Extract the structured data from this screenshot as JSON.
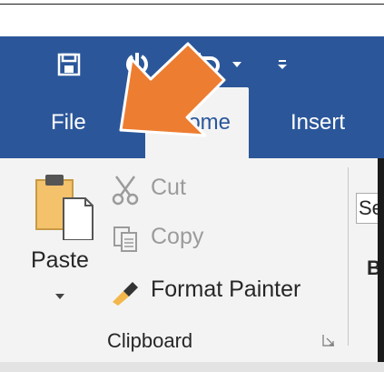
{
  "qat": {
    "save_icon": "save-icon",
    "autosave_icon": "autosave-refresh-icon",
    "undo_icon": "undo-icon",
    "undo_dropdown_icon": "chevron-down-icon",
    "customize_icon": "customize-qat-icon"
  },
  "tabs": [
    {
      "label": "File"
    },
    {
      "label": "Home"
    },
    {
      "label": "Insert"
    }
  ],
  "clipboard": {
    "paste_label": "Paste",
    "cut_label": "Cut",
    "copy_label": "Copy",
    "format_painter_label": "Format Painter",
    "group_label": "Clipboard"
  },
  "font_group": {
    "font_name_partial": "Se",
    "bold_label": "B"
  },
  "colors": {
    "ribbon_blue": "#2b579a",
    "ribbon_bg": "#f3f3f3",
    "annotation_arrow": "#ed7d31"
  }
}
